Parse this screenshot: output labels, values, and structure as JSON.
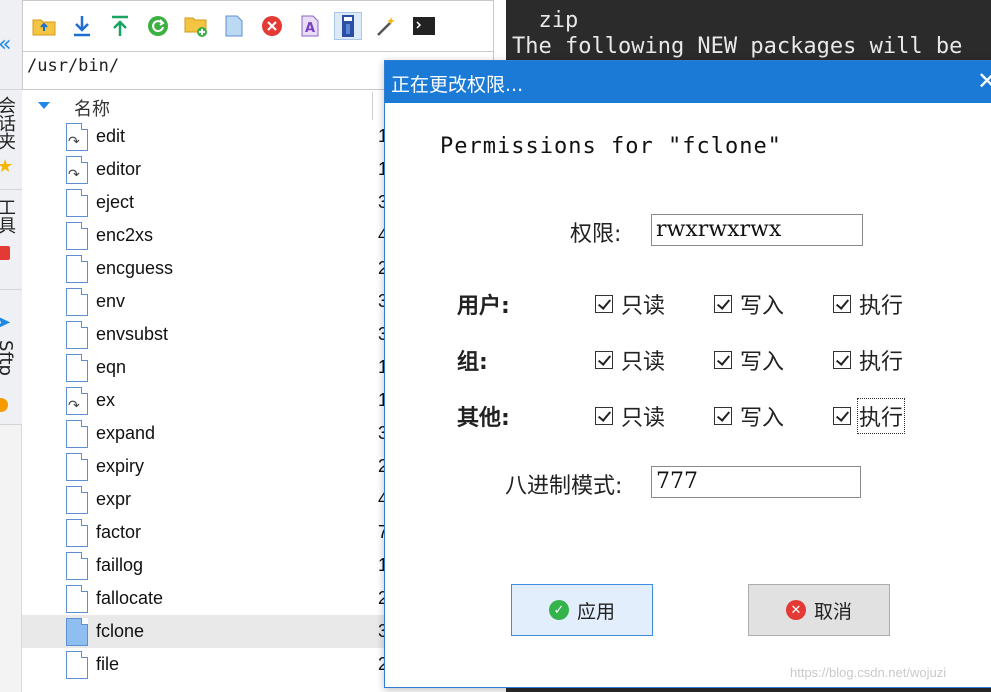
{
  "sidebar": {
    "tabs": [
      {
        "label": "会话夹"
      },
      {
        "label": "工具"
      },
      {
        "label": "Sftp"
      }
    ]
  },
  "toolbar": {
    "buttons": [
      {
        "icon": "folder-up-icon"
      },
      {
        "icon": "download-icon"
      },
      {
        "icon": "upload-icon"
      },
      {
        "icon": "refresh-icon"
      },
      {
        "icon": "new-folder-icon"
      },
      {
        "icon": "new-file-icon"
      },
      {
        "icon": "delete-icon"
      },
      {
        "icon": "rename-icon"
      },
      {
        "icon": "permissions-icon"
      },
      {
        "icon": "magic-wand-icon"
      },
      {
        "icon": "terminal-icon"
      }
    ]
  },
  "path": "/usr/bin/",
  "file_list": {
    "column_name": "名称",
    "rows": [
      {
        "name": "edit",
        "size": "1",
        "link": true
      },
      {
        "name": "editor",
        "size": "1",
        "link": true
      },
      {
        "name": "eject",
        "size": "3",
        "link": false
      },
      {
        "name": "enc2xs",
        "size": "4",
        "link": false
      },
      {
        "name": "encguess",
        "size": "2",
        "link": false
      },
      {
        "name": "env",
        "size": "3",
        "link": false
      },
      {
        "name": "envsubst",
        "size": "3",
        "link": false
      },
      {
        "name": "eqn",
        "size": "1",
        "link": false
      },
      {
        "name": "ex",
        "size": "1",
        "link": true
      },
      {
        "name": "expand",
        "size": "3",
        "link": false
      },
      {
        "name": "expiry",
        "size": "2",
        "link": false
      },
      {
        "name": "expr",
        "size": "4",
        "link": false
      },
      {
        "name": "factor",
        "size": "7",
        "link": false
      },
      {
        "name": "faillog",
        "size": "1",
        "link": false
      },
      {
        "name": "fallocate",
        "size": "2",
        "link": false
      },
      {
        "name": "fclone",
        "size": "3",
        "link": false,
        "selected": true
      },
      {
        "name": "file",
        "size": "2",
        "link": false
      }
    ]
  },
  "terminal": {
    "lines": [
      "  zip",
      "The following NEW packages will be"
    ]
  },
  "dialog": {
    "title": "正在更改权限...",
    "close_glyph": "✕",
    "heading": "Permissions for \"fclone\"",
    "perm_label": "权限:",
    "perm_value": "rwxrwxrwx",
    "groups": [
      {
        "label": "用户:",
        "read": "只读",
        "write": "写入",
        "exec": "执行"
      },
      {
        "label": "组:",
        "read": "只读",
        "write": "写入",
        "exec": "执行"
      },
      {
        "label": "其他:",
        "read": "只读",
        "write": "写入",
        "exec": "执行"
      }
    ],
    "octal_label": "八进制模式:",
    "octal_value": "777",
    "apply_label": "应用",
    "cancel_label": "取消"
  },
  "watermark": "https://blog.csdn.net/wojuzi",
  "colors": {
    "accent": "#1a7ad6",
    "terminal_bg": "#2b2b2b",
    "apply_icon": "#34b34a",
    "cancel_icon": "#e53935"
  }
}
